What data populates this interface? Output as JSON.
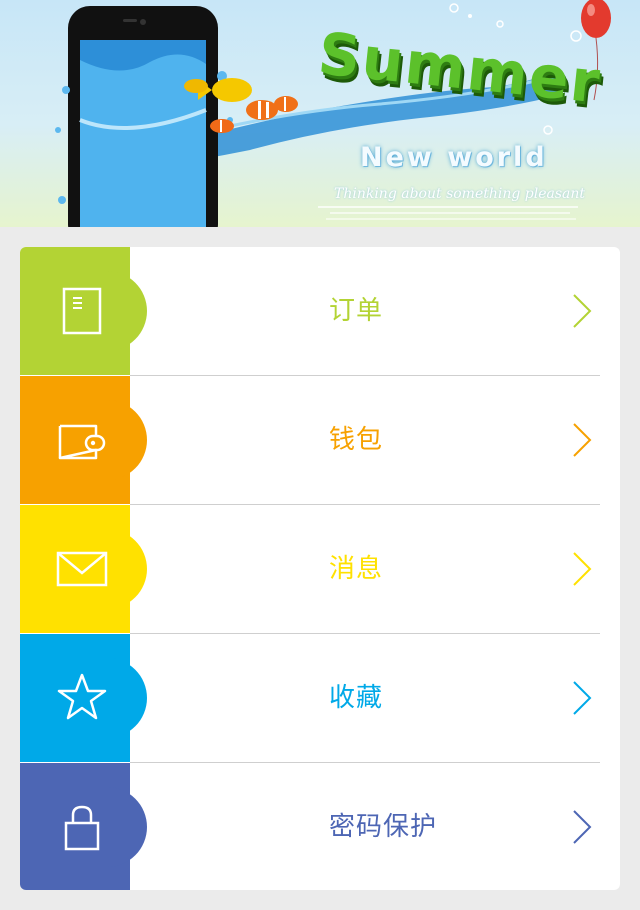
{
  "banner": {
    "title": "Summer",
    "subtitle": "New world",
    "tagline": "Thinking about something pleasant"
  },
  "menu": {
    "items": [
      {
        "label": "订单",
        "color": "#b3d334",
        "icon": "document-icon"
      },
      {
        "label": "钱包",
        "color": "#f7a100",
        "icon": "wallet-icon"
      },
      {
        "label": "消息",
        "color": "#ffe100",
        "icon": "envelope-icon"
      },
      {
        "label": "收藏",
        "color": "#00a9e8",
        "icon": "star-icon"
      },
      {
        "label": "密码保护",
        "color": "#4d66b4",
        "icon": "lock-icon"
      }
    ]
  },
  "colors": {
    "background": "#ebebeb",
    "card": "#ffffff",
    "divider": "#cfcfcf"
  }
}
